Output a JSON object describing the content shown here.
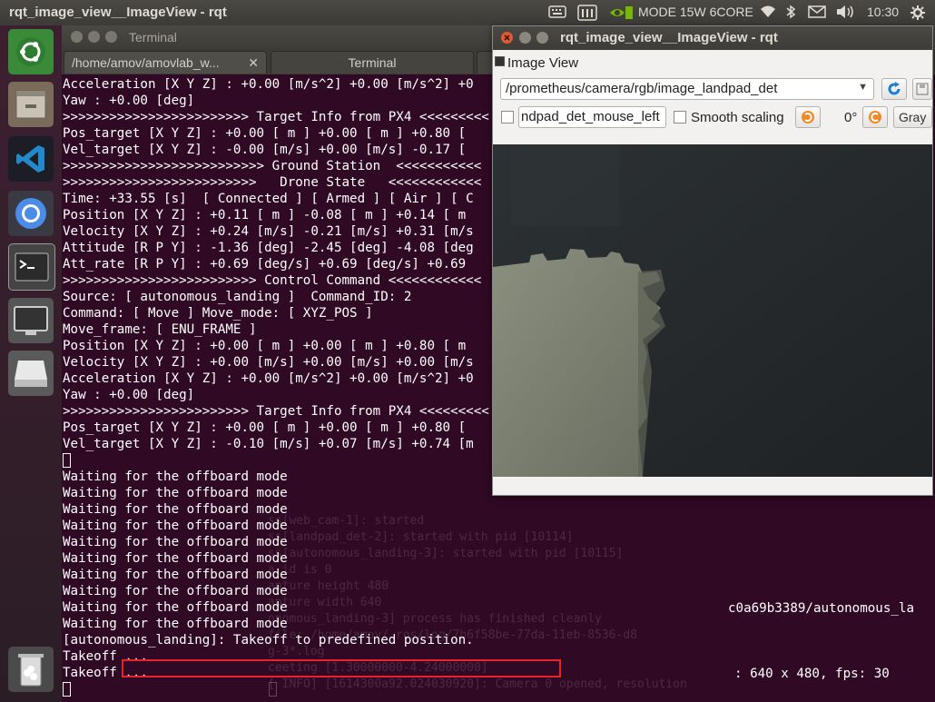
{
  "top_panel": {
    "window_title": "rqt_image_view__ImageView - rqt",
    "power_mode": "MODE 15W 6CORE",
    "clock": "10:30",
    "indicators": [
      "keyboard-icon",
      "nvidia-icon",
      "wifi-icon",
      "bluetooth-icon",
      "mail-icon",
      "volume-icon",
      "settings-icon"
    ]
  },
  "launcher": {
    "items": [
      "ubuntu-dash-icon",
      "file-manager-icon",
      "vscode-icon",
      "chromium-icon",
      "terminal-icon",
      "display-icon",
      "drive-icon",
      "trash-icon"
    ]
  },
  "terminal": {
    "title": "Terminal",
    "tabs": [
      "/home/amov/amovlab_w...",
      "Terminal"
    ],
    "lines": [
      "Acceleration [X Y Z] : +0.00 [m/s^2] +0.00 [m/s^2] +0",
      "Yaw : +0.00 [deg]",
      ">>>>>>>>>>>>>>>>>>>>>>>> Target Info from PX4 <<<<<<<<<",
      "Pos_target [X Y Z] : +0.00 [ m ] +0.00 [ m ] +0.80 [",
      "Vel_target [X Y Z] : -0.00 [m/s] +0.00 [m/s] -0.17 [",
      ">>>>>>>>>>>>>>>>>>>>>>>>>> Ground Station  <<<<<<<<<<<",
      ">>>>>>>>>>>>>>>>>>>>>>>>>   Drone State   <<<<<<<<<<<<",
      "Time: +33.55 [s]  [ Connected ] [ Armed ] [ Air ] [ C",
      "Position [X Y Z] : +0.11 [ m ] -0.08 [ m ] +0.14 [ m",
      "Velocity [X Y Z] : +0.24 [m/s] -0.21 [m/s] +0.31 [m/s",
      "Attitude [R P Y] : -1.36 [deg] -2.45 [deg] -4.08 [deg",
      "Att_rate [R P Y] : +0.69 [deg/s] +0.69 [deg/s] +0.69",
      ">>>>>>>>>>>>>>>>>>>>>>>>> Control Command <<<<<<<<<<<<",
      "Source: [ autonomous_landing ]  Command_ID: 2",
      "Command: [ Move ] Move_mode: [ XYZ_POS ]",
      "Move_frame: [ ENU_FRAME ]",
      "Position [X Y Z] : +0.00 [ m ] +0.00 [ m ] +0.80 [ m",
      "Velocity [X Y Z] : +0.00 [m/s] +0.00 [m/s] +0.00 [m/s",
      "Acceleration [X Y Z] : +0.00 [m/s^2] +0.00 [m/s^2] +0",
      "Yaw : +0.00 [deg]",
      ">>>>>>>>>>>>>>>>>>>>>>>> Target Info from PX4 <<<<<<<<<",
      "Pos_target [X Y Z] : +0.00 [ m ] +0.00 [ m ] +0.80 [",
      "Vel_target [X Y Z] : -0.10 [m/s] +0.07 [m/s] +0.74 [m",
      "",
      "Waiting for the offboard mode",
      "Waiting for the offboard mode",
      "Waiting for the offboard mode",
      "Waiting for the offboard mode",
      "Waiting for the offboard mode",
      "Waiting for the offboard mode",
      "Waiting for the offboard mode",
      "Waiting for the offboard mode",
      "Waiting for the offboard mode",
      "Waiting for the offboard mode",
      "[autonomous_landing]: Takeoff to predefined position.",
      "Takeoff ...",
      "Takeoff ..."
    ],
    "bg_fragments": [
      "ss[web_cam-1]: started",
      "ss[landpad_det-2]: started with pid [10114]",
      "ss[autonomous_landing-3]: started with pid [10115]",
      "a id is 0",
      "apture height 480",
      "apture width 640",
      "onomous_landing-3] process has finished cleanly",
      "file: /home/amov/.ros/log/7b6f58be-77da-11eb-8536-d8",
      "g-3*.log",
      "ceeting [1.30000000-4.24000000]",
      "[ INFO] [1614300a92.024030920]: Camera 0 opened, resolution"
    ],
    "right_text_1": "c0a69b3389/autonomous_la",
    "right_text_2": ": 640 x 480, fps: 30"
  },
  "rqt": {
    "title": "rqt_image_view__ImageView - rqt",
    "plugin_title": "Image View",
    "topic": "/prometheus/camera/rgb/image_landpad_det",
    "mouse_topic": "ndpad_det_mouse_left",
    "smooth_scaling_label": "Smooth scaling",
    "rotation": "0°",
    "color_scheme": "Gray"
  }
}
